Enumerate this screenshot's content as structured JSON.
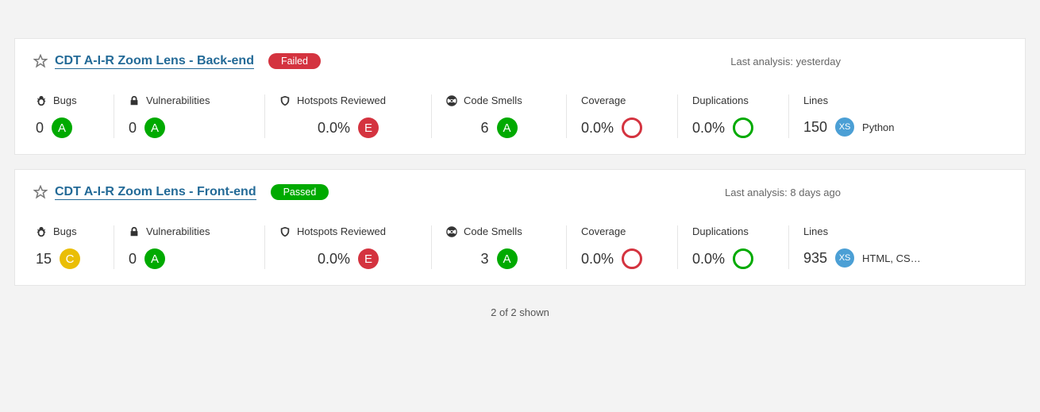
{
  "labels": {
    "bugs": "Bugs",
    "vulnerabilities": "Vulnerabilities",
    "hotspots": "Hotspots Reviewed",
    "code_smells": "Code Smells",
    "coverage": "Coverage",
    "duplications": "Duplications",
    "lines": "Lines",
    "last_analysis_prefix": "Last analysis:"
  },
  "footer": "2 of 2 shown",
  "projects": [
    {
      "name": "CDT A-I-R Zoom Lens - Back-end",
      "status_text": "Failed",
      "status_kind": "failed",
      "last_analysis": "yesterday",
      "bugs": {
        "value": "0",
        "rating": "A"
      },
      "vulnerabilities": {
        "value": "0",
        "rating": "A"
      },
      "hotspots": {
        "value": "0.0%",
        "rating": "E"
      },
      "code_smells": {
        "value": "6",
        "rating": "A"
      },
      "coverage": {
        "value": "0.0%",
        "ring": "red"
      },
      "duplications": {
        "value": "0.0%",
        "ring": "green"
      },
      "lines": {
        "value": "150",
        "size": "XS",
        "language": "Python"
      }
    },
    {
      "name": "CDT A-I-R Zoom Lens - Front-end",
      "status_text": "Passed",
      "status_kind": "passed",
      "last_analysis": "8 days ago",
      "bugs": {
        "value": "15",
        "rating": "C"
      },
      "vulnerabilities": {
        "value": "0",
        "rating": "A"
      },
      "hotspots": {
        "value": "0.0%",
        "rating": "E"
      },
      "code_smells": {
        "value": "3",
        "rating": "A"
      },
      "coverage": {
        "value": "0.0%",
        "ring": "red"
      },
      "duplications": {
        "value": "0.0%",
        "ring": "green"
      },
      "lines": {
        "value": "935",
        "size": "XS",
        "language": "HTML, CS…"
      }
    }
  ]
}
